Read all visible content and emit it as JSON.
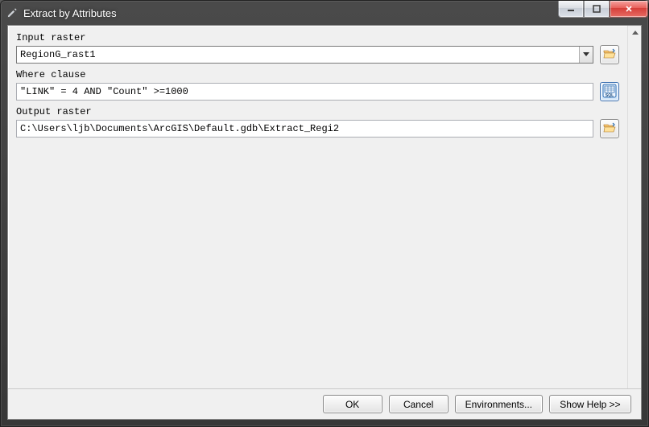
{
  "window": {
    "title": "Extract by Attributes"
  },
  "fields": {
    "input_raster": {
      "label": "Input raster",
      "value": "RegionG_rast1"
    },
    "where_clause": {
      "label": "Where clause",
      "value": "\"LINK\" = 4 AND \"Count\" >=1000"
    },
    "output_raster": {
      "label": "Output raster",
      "value": "C:\\Users\\ljb\\Documents\\ArcGIS\\Default.gdb\\Extract_Regi2"
    }
  },
  "buttons": {
    "ok": "OK",
    "cancel": "Cancel",
    "environments": "Environments...",
    "show_help": "Show Help >>"
  },
  "icons": {
    "sql_label": "SQL"
  }
}
